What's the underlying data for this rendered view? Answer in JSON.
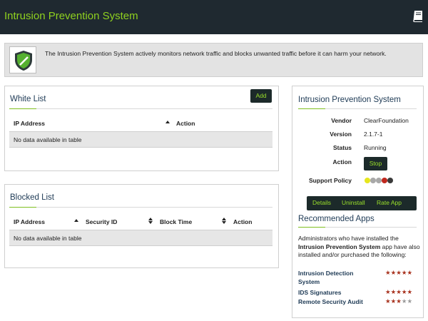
{
  "header": {
    "title": "Intrusion Prevention System",
    "book_icon": "book-icon"
  },
  "intro": {
    "icon": "shield-icon",
    "text": "The Intrusion Prevention System actively monitors network traffic and blocks unwanted traffic before it can harm your network."
  },
  "white_list": {
    "title": "White List",
    "add_label": "Add",
    "columns": [
      "IP Address",
      "Action"
    ],
    "empty_text": "No data available in table"
  },
  "blocked_list": {
    "title": "Blocked List",
    "columns": [
      "IP Address",
      "Security ID",
      "Block Time",
      "Action"
    ],
    "empty_text": "No data available in table"
  },
  "app_info": {
    "title": "Intrusion Prevention System",
    "vendor_label": "Vendor",
    "vendor": "ClearFoundation",
    "version_label": "Version",
    "version": "2.1.7-1",
    "status_label": "Status",
    "status": "Running",
    "action_label": "Action",
    "stop_label": "Stop",
    "support_label": "Support Policy",
    "support_dots": [
      "#e6e61e",
      "#a8a8a8",
      "#a8a8a8",
      "#c0281e",
      "#3a3a3a"
    ],
    "buttons": {
      "details": "Details",
      "uninstall": "Uninstall",
      "rate": "Rate App"
    }
  },
  "recommended": {
    "title": "Recommended Apps",
    "text_before": "Administrators who have installed the ",
    "text_bold": "Intrusion Prevention System",
    "text_after": " app have also installed and/or purchased the following:",
    "apps": [
      {
        "name_line1": "Intrusion Detection",
        "name_line2": "System",
        "rating": 5
      },
      {
        "name_line1": "IDS Signatures",
        "name_line2": "",
        "rating": 5
      },
      {
        "name_line1": "Remote Security Audit",
        "name_line2": "",
        "rating": 3
      }
    ],
    "star_color": "#a8321e",
    "star_empty_color": "#9a9a9a"
  },
  "colors": {
    "header_bg": "#1f2930",
    "accent_green": "#8fd11f",
    "button_bg": "#1c2a2a"
  }
}
